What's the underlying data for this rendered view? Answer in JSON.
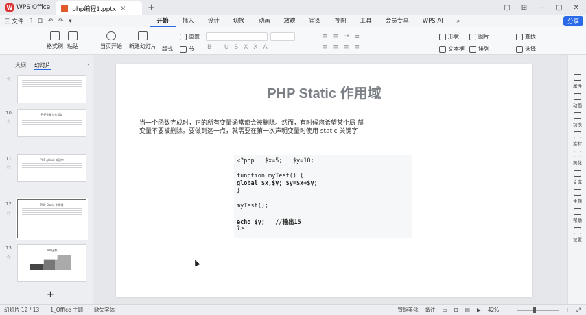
{
  "titlebar": {
    "app_name": "WPS Office",
    "doc_tab": "php编程1.pptx",
    "tab_close": "×",
    "tab_add": "+",
    "controls": [
      "▢",
      "⊞",
      "—",
      "▢",
      "✕"
    ]
  },
  "menubar": {
    "file_menu": "三 文件",
    "quick_icons": [
      "▯",
      "⊟",
      "↶",
      "↷",
      "▾"
    ],
    "tabs": [
      "开始",
      "插入",
      "设计",
      "切换",
      "动画",
      "放映",
      "审阅",
      "视图",
      "工具",
      "会员专享",
      "WPS AI"
    ],
    "active_tab": "开始",
    "search_icon": "⌕",
    "share": "分享"
  },
  "toolbar": {
    "format_painter": "格式刷",
    "paste": "粘贴",
    "play_from_start": "当页开始",
    "new_slide": "新建幻灯片",
    "layout": "版式",
    "section": "节",
    "reset": "重置",
    "shape": "形状",
    "image": "图片",
    "find": "查找",
    "textbox": "文本框",
    "arrange": "排列",
    "select": "选择"
  },
  "left_panel": {
    "tabs": [
      "大纲",
      "幻灯片"
    ],
    "active_tab": "幻灯片",
    "collapse": "‹",
    "add_slide": "+",
    "slides": [
      {
        "num": "",
        "title": ""
      },
      {
        "num": "10",
        "title": "PHP变量与作用域"
      },
      {
        "num": "11",
        "title": "PHP global 关键字"
      },
      {
        "num": "12",
        "title": "PHP Static 作用域"
      },
      {
        "num": "13",
        "title": "PHP函数"
      }
    ]
  },
  "slide": {
    "title": "PHP Static 作用域",
    "body_line1": "当一个函数完成时，它的所有变量通常都会被删除。然而，有时候您希望某个局 部",
    "body_line2": "变量不要被删除。要做到这一点，就需要在第一次声明变量时使用 static 关键字",
    "code": [
      "<?php   $x=5;   $y=10;",
      "",
      "function myTest() {",
      "global $x,$y; $y=$x+$y;",
      "}",
      "",
      "myTest();",
      "",
      "echo $y;   //输出15",
      "?>"
    ]
  },
  "right_panel": {
    "items": [
      "属性",
      "动画",
      "切换",
      "素材",
      "美化",
      "文库",
      "主题",
      "帮助",
      "设置"
    ]
  },
  "statusbar": {
    "slide_counter": "幻灯片 12 / 13",
    "theme": "1_Office 主题",
    "missing_font": "缺失字体",
    "smart_beautify": "智能美化",
    "notes": "备注",
    "zoom": "42%",
    "zoom_level": 0.42
  }
}
